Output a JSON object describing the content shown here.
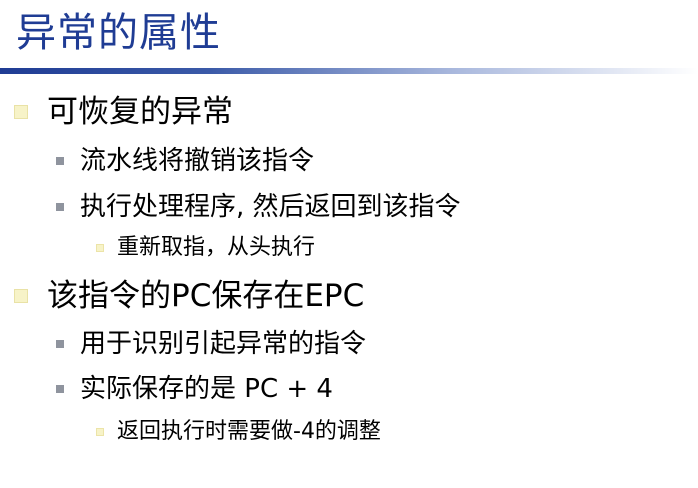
{
  "slide": {
    "title": "异常的属性",
    "accent_color": "#1f3c94"
  },
  "bullets": [
    {
      "level": 1,
      "text": "可恢复的异常"
    },
    {
      "level": 2,
      "text": "流水线将撤销该指令"
    },
    {
      "level": 2,
      "text": "执行处理程序, 然后返回到该指令"
    },
    {
      "level": 3,
      "text": "重新取指，从头执行"
    },
    {
      "level": 1,
      "text": "该指令的PC保存在EPC"
    },
    {
      "level": 2,
      "text": "用于识别引起异常的指令"
    },
    {
      "level": 2,
      "text": "实际保存的是 PC + 4"
    },
    {
      "level": 3,
      "text": "返回执行时需要做-4的调整"
    }
  ]
}
